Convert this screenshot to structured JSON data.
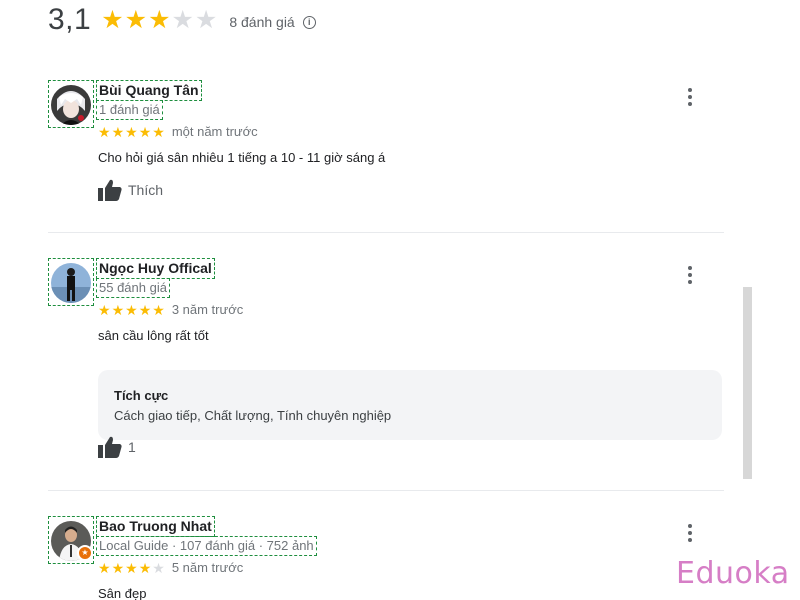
{
  "summary": {
    "score": "3,1",
    "rating": 3,
    "max_rating": 5,
    "count_text": "8 đánh giá",
    "info_icon": "info-icon"
  },
  "colors": {
    "star_filled": "#fbbc04",
    "star_empty": "#dadce0",
    "guide_badge": "#e8710a",
    "watermark": "#d67ec6"
  },
  "reviews": [
    {
      "author": "Bùi Quang Tân",
      "meta": "1 đánh giá",
      "rating": 5,
      "date": "một năm trước",
      "text": "Cho hỏi giá sân nhiêu 1 tiếng a 10 - 11 giờ sáng á",
      "like_label": "Thích"
    },
    {
      "author": "Ngọc Huy Offical",
      "meta": "55 đánh giá",
      "rating": 5,
      "date": "3 năm trước",
      "text": "sân cầu lông rất tốt",
      "feedback_title": "Tích cực",
      "feedback_items": "Cách giao tiếp, Chất lượng, Tính chuyên nghiệp",
      "like_label": "1"
    },
    {
      "author": "Bao Truong Nhat",
      "meta": "Local Guide · 107 đánh giá · 752 ảnh",
      "rating": 4,
      "date": "5 năm trước",
      "text": "Sân đẹp"
    }
  ],
  "watermark": "Eduoka"
}
